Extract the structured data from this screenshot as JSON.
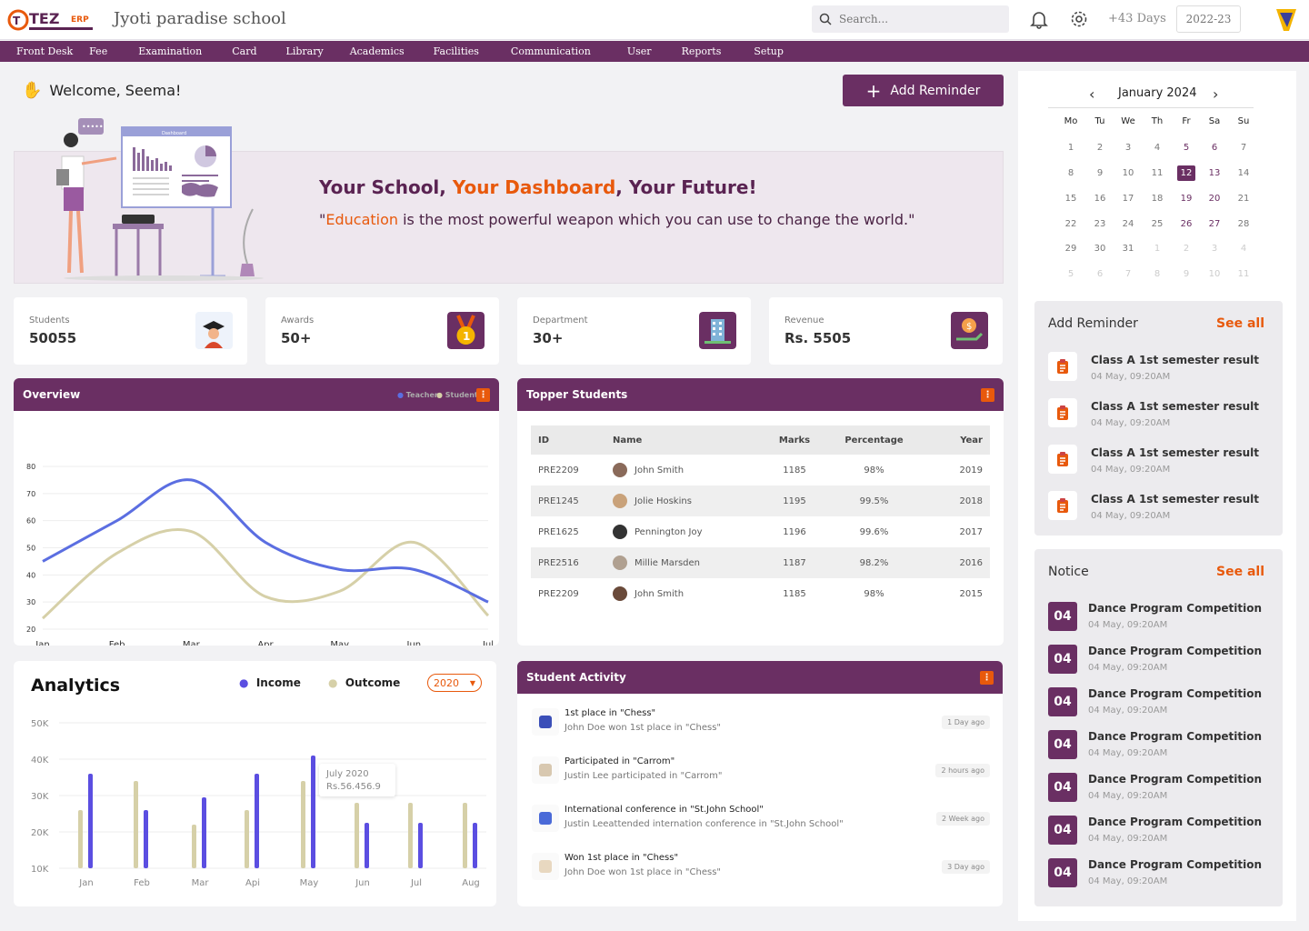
{
  "header": {
    "school_name": "Jyoti paradise school",
    "search_placeholder": "Search...",
    "days": "+43 Days",
    "session": "2022-23",
    "logo_text": "TEZ",
    "logo_sub": "ERP"
  },
  "nav": [
    "Front Desk",
    "Fee",
    "Examination",
    "Card",
    "Library",
    "Academics",
    "Facilities",
    "Communication",
    "User",
    "Reports",
    "Setup"
  ],
  "welcome": "Welcome, Seema!",
  "add_reminder_label": "Add Reminder",
  "banner": {
    "t1": "Your School, ",
    "t2": "Your Dashboard",
    "t3": ", Your Future!",
    "q1": "\"",
    "q2": "Education",
    "q3": " is the most powerful weapon which you can use to change the world.\"",
    "board_label": "Dashboard"
  },
  "stats": [
    {
      "label": "Students",
      "value": "50055"
    },
    {
      "label": "Awards",
      "value": "50+"
    },
    {
      "label": "Department",
      "value": "30+"
    },
    {
      "label": "Revenue",
      "value": "Rs. 5505"
    }
  ],
  "overview": {
    "title": "Overview",
    "legend": [
      "Teacher",
      "Student"
    ],
    "kebab": "⋮"
  },
  "topper": {
    "title": "Topper Students",
    "headers": [
      "ID",
      "Name",
      "Marks",
      "Percentage",
      "Year"
    ],
    "rows": [
      [
        "PRE2209",
        "John Smith",
        "1185",
        "98%",
        "2019"
      ],
      [
        "PRE1245",
        "Jolie Hoskins",
        "1195",
        "99.5%",
        "2018"
      ],
      [
        "PRE1625",
        "Pennington Joy",
        "1196",
        "99.6%",
        "2017"
      ],
      [
        "PRE2516",
        "Millie Marsden",
        "1187",
        "98.2%",
        "2016"
      ],
      [
        "PRE2209",
        "John Smith",
        "1185",
        "98%",
        "2015"
      ]
    ]
  },
  "analytics": {
    "title": "Analytics",
    "legend_income": "Income",
    "legend_outcome": "Outcome",
    "year": "2020",
    "tooltip_t": "July 2020",
    "tooltip_v": "Rs.56.456.9"
  },
  "activity": {
    "title": "Student Activity",
    "items": [
      {
        "t": "1st place in \"Chess\"",
        "s": "John Doe won 1st place in \"Chess\"",
        "b": "1 Day ago"
      },
      {
        "t": "Participated in \"Carrom\"",
        "s": "Justin Lee participated in \"Carrom\"",
        "b": "2 hours ago"
      },
      {
        "t": "International conference in \"St.John School\"",
        "s": "Justin Leeattended internation conference in \"St.John School\"",
        "b": "2 Week ago"
      },
      {
        "t": "Won 1st place in \"Chess\"",
        "s": "John Doe won 1st place in \"Chess\"",
        "b": "3 Day ago"
      }
    ]
  },
  "calendar": {
    "month": "January 2024",
    "days": [
      "Mo",
      "Tu",
      "We",
      "Th",
      "Fr",
      "Sa",
      "Su"
    ],
    "weeks": [
      [
        "1",
        "2",
        "3",
        "4",
        "5",
        "6",
        "7"
      ],
      [
        "8",
        "9",
        "10",
        "11",
        "12",
        "13",
        "14"
      ],
      [
        "15",
        "16",
        "17",
        "18",
        "19",
        "20",
        "21"
      ],
      [
        "22",
        "23",
        "24",
        "25",
        "26",
        "27",
        "28"
      ],
      [
        "29",
        "30",
        "31",
        "1",
        "2",
        "3",
        "4"
      ],
      [
        "5",
        "6",
        "7",
        "8",
        "9",
        "10",
        "11"
      ]
    ],
    "selected": "12"
  },
  "reminders": {
    "title": "Add Reminder",
    "see_all": "See all",
    "items": [
      {
        "t": "Class A 1st semester result",
        "s": "04 May, 09:20AM"
      },
      {
        "t": "Class A 1st semester result",
        "s": "04 May, 09:20AM"
      },
      {
        "t": "Class A 1st semester result",
        "s": "04 May, 09:20AM"
      },
      {
        "t": "Class A 1st semester result",
        "s": "04 May, 09:20AM"
      }
    ]
  },
  "notice": {
    "title": "Notice",
    "see_all": "See all",
    "items": [
      {
        "d": "04",
        "t": "Dance Program Competition",
        "s": "04 May, 09:20AM"
      },
      {
        "d": "04",
        "t": "Dance Program Competition",
        "s": "04 May, 09:20AM"
      },
      {
        "d": "04",
        "t": "Dance Program Competition",
        "s": "04 May, 09:20AM"
      },
      {
        "d": "04",
        "t": "Dance Program Competition",
        "s": "04 May, 09:20AM"
      },
      {
        "d": "04",
        "t": "Dance Program Competition",
        "s": "04 May, 09:20AM"
      },
      {
        "d": "04",
        "t": "Dance Program Competition",
        "s": "04 May, 09:20AM"
      },
      {
        "d": "04",
        "t": "Dance Program Competition",
        "s": "04 May, 09:20AM"
      }
    ]
  },
  "colors": {
    "primary": "#6a2f63",
    "accent": "#e8590c",
    "teacher": "#5b6ee1",
    "student": "#d6d0a8"
  },
  "chart_data": [
    {
      "type": "line",
      "title": "Overview",
      "categories": [
        "Jan",
        "Feb",
        "Mar",
        "Apr",
        "May",
        "Jun",
        "Jul"
      ],
      "ylim": [
        20,
        80
      ],
      "yticks": [
        20,
        30,
        40,
        50,
        60,
        70,
        80
      ],
      "series": [
        {
          "name": "Teacher",
          "values": [
            45,
            60,
            75,
            52,
            42,
            42,
            30
          ]
        },
        {
          "name": "Student",
          "values": [
            24,
            48,
            56,
            32,
            34,
            52,
            25
          ]
        }
      ]
    },
    {
      "type": "bar",
      "title": "Analytics",
      "categories": [
        "Jan",
        "Feb",
        "Mar",
        "Api",
        "May",
        "Jun",
        "Jul",
        "Aug"
      ],
      "ylim": [
        10000,
        50000
      ],
      "yticks": [
        "10K",
        "20K",
        "30K",
        "40K",
        "50K"
      ],
      "series": [
        {
          "name": "Outcome",
          "values": [
            26000,
            34000,
            22000,
            26000,
            34000,
            28000,
            28000,
            28000
          ]
        },
        {
          "name": "Income",
          "values": [
            36000,
            26000,
            29500,
            36000,
            41000,
            22500,
            22500,
            22500
          ]
        }
      ]
    }
  ]
}
